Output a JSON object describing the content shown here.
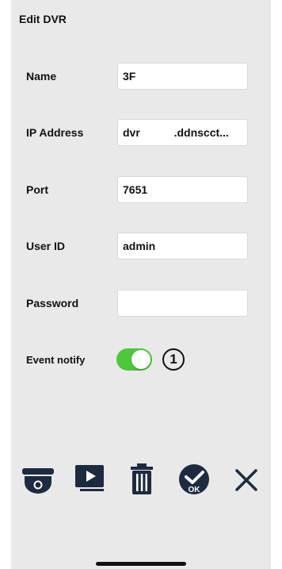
{
  "header": {
    "title": "Edit DVR"
  },
  "form": {
    "name": {
      "label": "Name",
      "value": "3F"
    },
    "ip": {
      "label": "IP Address",
      "value": "dvr           .ddnscct..."
    },
    "port": {
      "label": "Port",
      "value": "7651"
    },
    "user": {
      "label": "User ID",
      "value": "admin"
    },
    "password": {
      "label": "Password",
      "value": ""
    },
    "event": {
      "label": "Event notify",
      "enabled": true,
      "badge": "1"
    }
  },
  "toolbar": {
    "items": [
      "camera-icon",
      "play-icon",
      "trash-icon",
      "ok-icon",
      "close-icon"
    ]
  },
  "colors": {
    "background": "#e9e9e9",
    "toggle_on": "#4cc83a",
    "icon": "#1c2b3f"
  }
}
